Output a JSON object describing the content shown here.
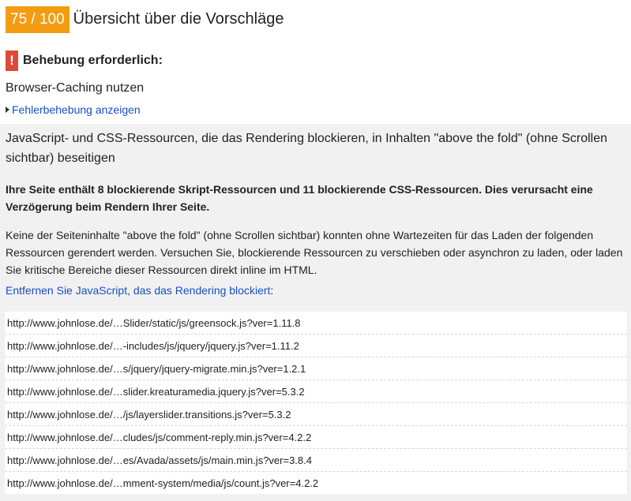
{
  "header": {
    "score": "75 / 100",
    "title": "Übersicht über die Vorschläge"
  },
  "severity": {
    "icon": "exclamation-icon",
    "icon_glyph": "!",
    "label": "Behebung erforderlich:",
    "color": "#dd4b39"
  },
  "rule": {
    "title": "Browser-Caching nutzen",
    "toggle_label": "Fehlerbehebung anzeigen"
  },
  "panel": {
    "title": "JavaScript- und CSS-Ressourcen, die das Rendering blockieren, in Inhalten \"above the fold\" (ohne Scrollen sichtbar) beseitigen",
    "summary": "Ihre Seite enthält 8 blockierende Skript-Ressourcen und 11 blockierende CSS-Ressourcen. Dies verursacht eine Verzögerung beim Rendern Ihrer Seite.",
    "description": "Keine der Seiteninhalte \"above the fold\" (ohne Scrollen sichtbar) konnten ohne Wartezeiten für das Laden der folgenden Ressourcen gerendert werden. Versuchen Sie, blockierende Ressourcen zu verschieben oder asynchron zu laden, oder laden Sie kritische Bereiche dieser Ressourcen direkt inline im HTML.",
    "link_label": "Entfernen Sie JavaScript, das das Rendering blockiert",
    "link_suffix": ":",
    "resources": [
      "http://www.johnlose.de/…Slider/static/js/greensock.js?ver=1.11.8",
      "http://www.johnlose.de/…-includes/js/jquery/jquery.js?ver=1.11.2",
      "http://www.johnlose.de/…s/jquery/jquery-migrate.min.js?ver=1.2.1",
      "http://www.johnlose.de/…slider.kreaturamedia.jquery.js?ver=5.3.2",
      "http://www.johnlose.de/…/js/layerslider.transitions.js?ver=5.3.2",
      "http://www.johnlose.de/…cludes/js/comment-reply.min.js?ver=4.2.2",
      "http://www.johnlose.de/…es/Avada/assets/js/main.min.js?ver=3.8.4",
      "http://www.johnlose.de/…mment-system/media/js/count.js?ver=4.2.2"
    ]
  },
  "colors": {
    "score_bg": "#f39c12",
    "link": "#1a4ec1",
    "panel_bg": "#f1f1f1"
  }
}
